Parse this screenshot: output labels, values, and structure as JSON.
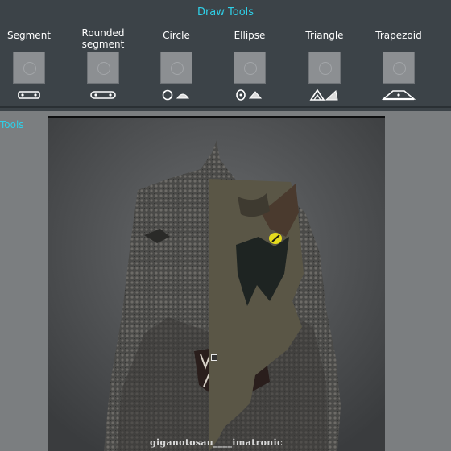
{
  "draw_tools": {
    "title": "Draw Tools",
    "tools": [
      {
        "label": "Segment",
        "icons": "segment-icons"
      },
      {
        "label": "Rounded segment",
        "icons": "rounded-segment-icons"
      },
      {
        "label": "Circle",
        "icons": "circle-icons"
      },
      {
        "label": "Ellipse",
        "icons": "ellipse-icons"
      },
      {
        "label": "Triangle",
        "icons": "triangle-icons"
      },
      {
        "label": "Trapezoid",
        "icons": "trapezoid-icons"
      }
    ]
  },
  "workspace": {
    "tools_tab": "Tools",
    "image_caption": "giganotosau____imatronic"
  },
  "colors": {
    "accent": "#2fd0e8",
    "panel": "#3c4348",
    "workspace": "#7b7e80",
    "overlay": "#5a5646",
    "eye": "#e6dc1e"
  }
}
